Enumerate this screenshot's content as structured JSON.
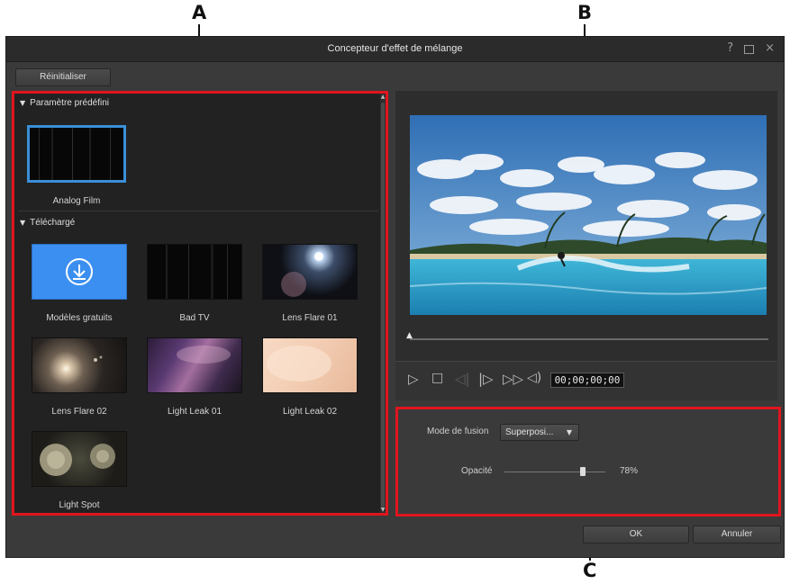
{
  "callouts": {
    "a": "A",
    "b": "B",
    "c": "C"
  },
  "window": {
    "title": "Concepteur d'effet de mélange",
    "help_glyph": "?",
    "close_glyph": "×"
  },
  "toolbar": {
    "reset_label": "Réinitialiser"
  },
  "effects": {
    "section_preset": "Paramètre prédéfini",
    "section_downloaded": "Téléchargé",
    "preset_items": [
      {
        "label": "Analog Film",
        "icon": "analog-film-thumbnail",
        "selected": true
      }
    ],
    "downloaded_items": [
      {
        "label": "Modèles gratuits",
        "icon": "download-icon"
      },
      {
        "label": "Bad TV",
        "icon": "bad-tv-thumbnail"
      },
      {
        "label": "Lens Flare 01",
        "icon": "lens-flare-thumbnail"
      },
      {
        "label": "Lens Flare 02",
        "icon": "lens-flare-thumbnail"
      },
      {
        "label": "Light Leak 01",
        "icon": "light-leak-thumbnail"
      },
      {
        "label": "Light Leak 02",
        "icon": "light-leak-thumbnail"
      },
      {
        "label": "Light Spot",
        "icon": "light-spot-thumbnail"
      }
    ]
  },
  "player": {
    "timecode": "00;00;00;00",
    "playhead_position": 0,
    "controls": [
      "play-icon",
      "stop-icon",
      "previous-frame-icon",
      "next-frame-icon",
      "fast-forward-icon",
      "volume-icon"
    ]
  },
  "settings": {
    "blend_mode_label": "Mode de fusion",
    "blend_mode_value": "Superposi...",
    "opacity_label": "Opacité",
    "opacity_value": "78%",
    "opacity_fraction": 0.78
  },
  "footer": {
    "ok_label": "OK",
    "cancel_label": "Annuler"
  },
  "colors": {
    "highlight_red": "#e0151e",
    "selection_blue": "#3a8fd8",
    "download_tile_blue": "#3b8ff0",
    "panel_dark": "#222222",
    "window_bg": "#3a3a3a"
  }
}
